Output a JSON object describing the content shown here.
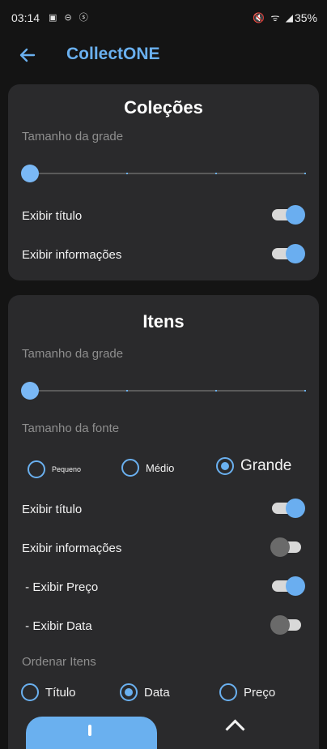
{
  "status": {
    "time": "03:14",
    "battery": "35%"
  },
  "appbar": {
    "title": "CollectONE"
  },
  "colecoes": {
    "title": "Coleções",
    "grid_size_label": "Tamanho da grade",
    "grid_size_level": 0,
    "show_title_label": "Exibir título",
    "show_title_on": true,
    "show_info_label": "Exibir informações",
    "show_info_on": true
  },
  "itens": {
    "title": "Itens",
    "grid_size_label": "Tamanho da grade",
    "grid_size_level": 0,
    "font_size_label": "Tamanho da fonte",
    "font_options": [
      "Pequeno",
      "Médio",
      "Grande"
    ],
    "font_selected": "Grande",
    "show_title_label": "Exibir título",
    "show_title_on": true,
    "show_info_label": "Exibir informações",
    "show_info_on": false,
    "show_price_label": " - Exibir Preço",
    "show_price_on": true,
    "show_date_label": " - Exibir Data",
    "show_date_on": false,
    "order_label": "Ordenar Itens",
    "order_options": [
      "Título",
      "Data",
      "Preço"
    ],
    "order_selected": "Data"
  },
  "colors": {
    "accent": "#6ab0ef",
    "card": "#2a2a2c",
    "background": "#141414"
  }
}
